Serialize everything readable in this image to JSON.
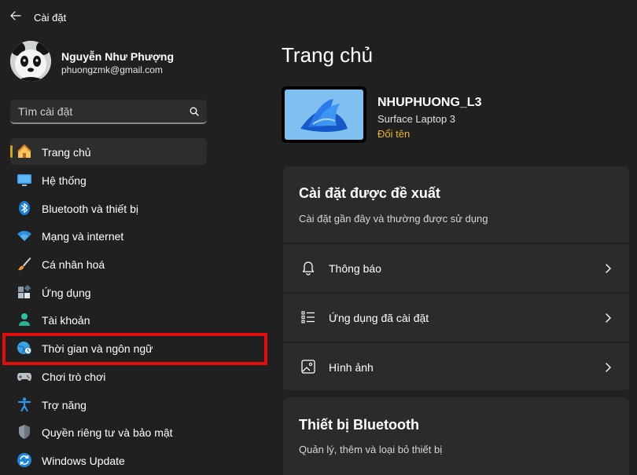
{
  "app": {
    "title": "Cài đặt"
  },
  "user": {
    "name": "Nguyễn Như Phượng",
    "email": "phuongzmk@gmail.com"
  },
  "search": {
    "placeholder": "Tìm cài đặt"
  },
  "nav": {
    "items": [
      {
        "label": "Trang chủ",
        "icon": "home-icon",
        "active": true
      },
      {
        "label": "Hệ thống",
        "icon": "display-icon"
      },
      {
        "label": "Bluetooth và thiết bị",
        "icon": "bluetooth-icon"
      },
      {
        "label": "Mạng và internet",
        "icon": "wifi-icon"
      },
      {
        "label": "Cá nhân hoá",
        "icon": "paintbrush-icon"
      },
      {
        "label": "Ứng dụng",
        "icon": "apps-icon"
      },
      {
        "label": "Tài khoản",
        "icon": "person-icon"
      },
      {
        "label": "Thời gian và ngôn ngữ",
        "icon": "globe-clock-icon"
      },
      {
        "label": "Chơi trò chơi",
        "icon": "gamepad-icon"
      },
      {
        "label": "Trợ năng",
        "icon": "accessibility-icon"
      },
      {
        "label": "Quyền riêng tư và bảo mật",
        "icon": "shield-icon"
      },
      {
        "label": "Windows Update",
        "icon": "update-icon"
      }
    ]
  },
  "main": {
    "title": "Trang chủ",
    "device": {
      "name": "NHUPHUONG_L3",
      "model": "Surface Laptop 3",
      "rename": "Đổi tên"
    },
    "recommended": {
      "title": "Cài đặt được đề xuất",
      "subtitle": "Cài đặt gần đây và thường được sử dụng",
      "rows": [
        {
          "label": "Thông báo",
          "icon": "bell-icon"
        },
        {
          "label": "Ứng dụng đã cài đặt",
          "icon": "list-icon"
        },
        {
          "label": "Hình ảnh",
          "icon": "image-icon"
        }
      ]
    },
    "bluetooth": {
      "title": "Thiết bị Bluetooth",
      "subtitle": "Quản lý, thêm và loại bỏ thiết bị"
    }
  },
  "colors": {
    "accent": "#d4a216",
    "link": "#e7b525",
    "highlight": "#e30d0d",
    "background": "#202020",
    "card": "#2b2b2b"
  }
}
